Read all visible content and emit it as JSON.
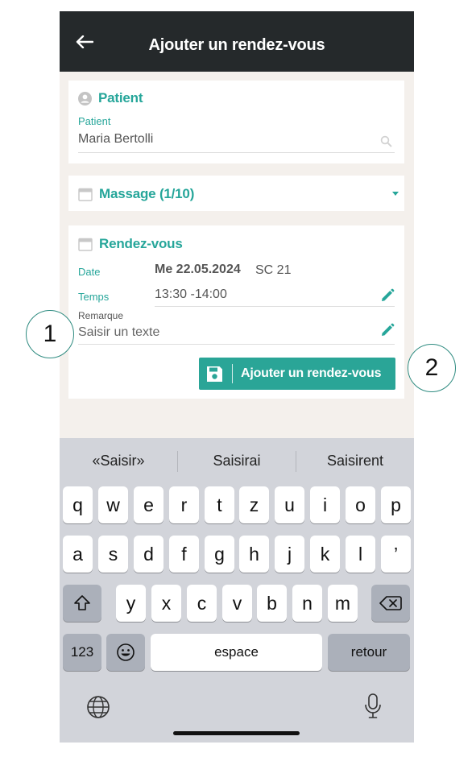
{
  "header": {
    "title": "Ajouter un rendez-vous"
  },
  "patient_card": {
    "title": "Patient",
    "field_label": "Patient",
    "field_value": "Maria Bertolli"
  },
  "treatment_card": {
    "title": "Massage (1/10)"
  },
  "appointment_card": {
    "title": "Rendez-vous",
    "date_label": "Date",
    "date_value": "Me 22.05.2024",
    "date_code": "SC 21",
    "time_label": "Temps",
    "time_value": "13:30 -14:00",
    "remark_label": "Remarque",
    "remark_placeholder": "Saisir un texte",
    "save_button_label": "Ajouter un rendez-vous"
  },
  "keyboard": {
    "suggestions": [
      "«Saisir»",
      "Saisirai",
      "Saisirent"
    ],
    "row1": [
      "q",
      "w",
      "e",
      "r",
      "t",
      "z",
      "u",
      "i",
      "o",
      "p"
    ],
    "row2": [
      "a",
      "s",
      "d",
      "f",
      "g",
      "h",
      "j",
      "k",
      "l",
      "’"
    ],
    "row3": [
      "y",
      "x",
      "c",
      "v",
      "b",
      "n",
      "m"
    ],
    "numbers_key": "123",
    "space_key": "espace",
    "return_key": "retour"
  },
  "callouts": [
    "1",
    "2"
  ],
  "colors": {
    "accent": "#26a69a",
    "header_bg": "#25292b",
    "keyboard_bg": "#d2d4da"
  }
}
